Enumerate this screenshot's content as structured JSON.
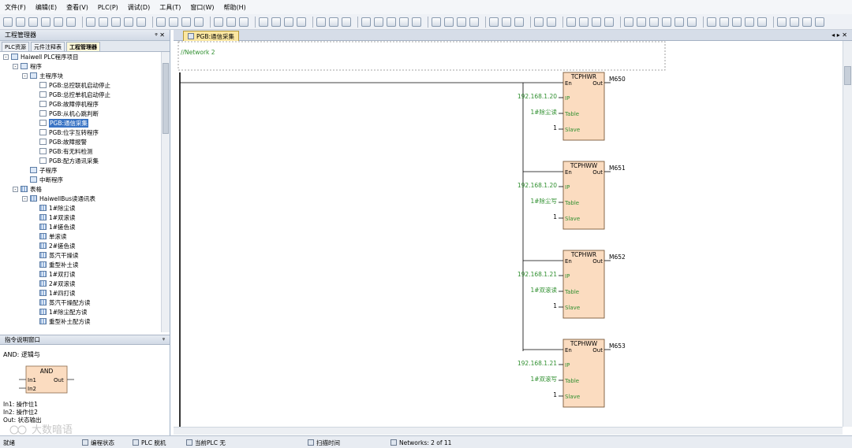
{
  "menu": [
    "文件(F)",
    "编辑(E)",
    "查看(V)",
    "PLC(P)",
    "调试(D)",
    "工具(T)",
    "窗口(W)",
    "帮助(H)"
  ],
  "left_panel": {
    "title": "工程管理器",
    "pin": "ᵠ ✕",
    "tabs": [
      "PLC资源",
      "元件注释表",
      "工程管理器"
    ],
    "tree": [
      {
        "label": "Haiwell PLC程序项目",
        "indent": 0,
        "icon": "folder",
        "exp": "-"
      },
      {
        "label": "程序",
        "indent": 1,
        "icon": "folder",
        "exp": "-"
      },
      {
        "label": "主程序块",
        "indent": 2,
        "icon": "folder",
        "exp": "-"
      },
      {
        "label": "PGB:总控联机启动停止",
        "indent": 3,
        "icon": "doc"
      },
      {
        "label": "PGB:总控单机启动停止",
        "indent": 3,
        "icon": "doc"
      },
      {
        "label": "PGB:故障停机程序",
        "indent": 3,
        "icon": "doc"
      },
      {
        "label": "PGB:从机心跳判断",
        "indent": 3,
        "icon": "doc"
      },
      {
        "label": "PGB:通信采集",
        "indent": 3,
        "icon": "doc",
        "selected": true
      },
      {
        "label": "PGB:位字互转程序",
        "indent": 3,
        "icon": "doc"
      },
      {
        "label": "PGB:故障报警",
        "indent": 3,
        "icon": "doc"
      },
      {
        "label": "PGB:有无料检测",
        "indent": 3,
        "icon": "doc"
      },
      {
        "label": "PGB:配方通讯采集",
        "indent": 3,
        "icon": "doc"
      },
      {
        "label": "子程序",
        "indent": 2,
        "icon": "folder"
      },
      {
        "label": "中断程序",
        "indent": 2,
        "icon": "folder"
      },
      {
        "label": "表格",
        "indent": 1,
        "icon": "grid",
        "exp": "-"
      },
      {
        "label": "HaiwellBus读通讯表",
        "indent": 2,
        "icon": "grid",
        "exp": "-"
      },
      {
        "label": "1#除尘读",
        "indent": 3,
        "icon": "grid"
      },
      {
        "label": "1#双滚读",
        "indent": 3,
        "icon": "grid"
      },
      {
        "label": "1#搓色读",
        "indent": 3,
        "icon": "grid"
      },
      {
        "label": "单滚读",
        "indent": 3,
        "icon": "grid"
      },
      {
        "label": "2#搓色读",
        "indent": 3,
        "icon": "grid"
      },
      {
        "label": "蒸汽干燥读",
        "indent": 3,
        "icon": "grid"
      },
      {
        "label": "重型补土读",
        "indent": 3,
        "icon": "grid"
      },
      {
        "label": "1#双打读",
        "indent": 3,
        "icon": "grid"
      },
      {
        "label": "2#双滚读",
        "indent": 3,
        "icon": "grid"
      },
      {
        "label": "1#四打读",
        "indent": 3,
        "icon": "grid"
      },
      {
        "label": "蒸汽干燥配方读",
        "indent": 3,
        "icon": "grid"
      },
      {
        "label": "1#除尘配方读",
        "indent": 3,
        "icon": "grid"
      },
      {
        "label": "重型补土配方读",
        "indent": 3,
        "icon": "grid"
      }
    ]
  },
  "info_panel": {
    "title": "指令说明窗口",
    "pin": "ᵠ",
    "instruction": "AND: 逻辑与",
    "block_name": "AND",
    "in1": "In1",
    "in2": "In2",
    "out": "Out",
    "desc1": "In1: 操作位1",
    "desc2": "In2: 操作位2",
    "desc3": "Out: 状态输出",
    "watermark": "大数暗语"
  },
  "editor": {
    "tab_label": "PGB:通信采集",
    "network_label": "//Network 2",
    "blocks": [
      {
        "name": "TCPHWR",
        "coil": "M650",
        "ip": "192.168.1.20",
        "table": "1#除尘读",
        "slave": "1"
      },
      {
        "name": "TCPHWW",
        "coil": "M651",
        "ip": "192.168.1.20",
        "table": "1#除尘写",
        "slave": "1"
      },
      {
        "name": "TCPHWR",
        "coil": "M652",
        "ip": "192.168.1.21",
        "table": "1#双滚读",
        "slave": "1"
      },
      {
        "name": "TCPHWW",
        "coil": "M653",
        "ip": "192.168.1.21",
        "table": "1#双滚写",
        "slave": "1"
      }
    ],
    "pin_en": "En",
    "pin_out": "Out",
    "pin_ip": "IP",
    "pin_table": "Table",
    "pin_slave": "Slave"
  },
  "nav_arrows": "◂ ▸ ✕",
  "status": {
    "ready": "就绪",
    "mode": "编程状态",
    "plc": "PLC 脱机",
    "current_plc": "当前PLC 无",
    "scan": "扫描时间",
    "networks": "Networks: 2 of 11"
  },
  "colors": {
    "block_fill": "#fbdcc0",
    "param_text": "#2f8f2f",
    "selection": "#3873c4",
    "tab_active": "#fbe7a1"
  }
}
